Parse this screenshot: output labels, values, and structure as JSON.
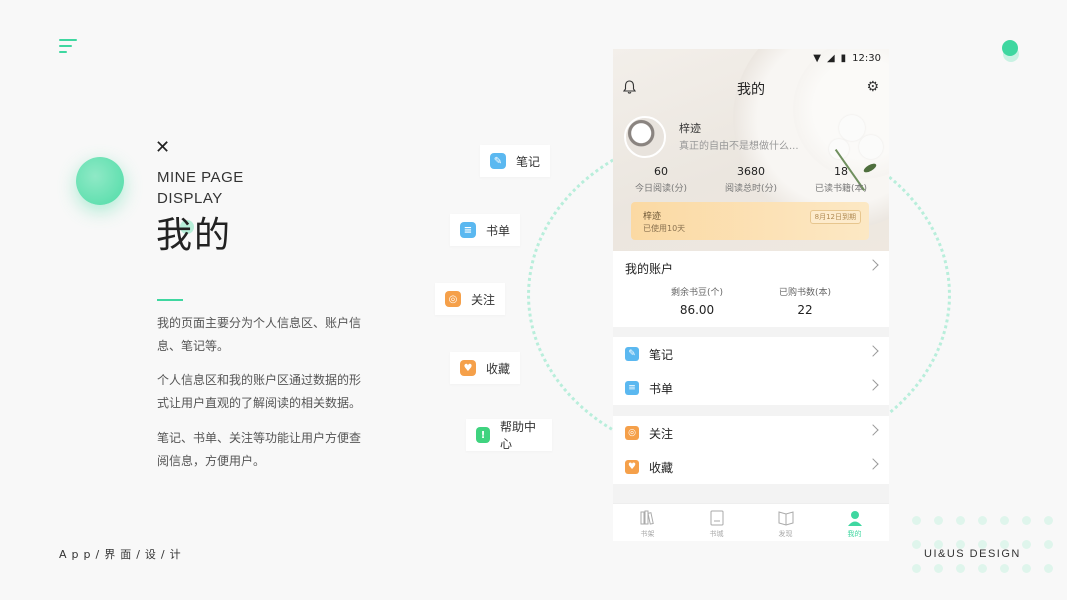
{
  "left": {
    "en_title_line1": "MINE PAGE",
    "en_title_line2": "DISPLAY",
    "zh_title": "我的",
    "desc1": "我的页面主要分为个人信息区、账户信息、笔记等。",
    "desc2": "个人信息区和我的账户区通过数据的形式让用户直观的了解阅读的相关数据。",
    "desc3": "笔记、书单、关注等功能让用户方便查阅信息，方便用户。"
  },
  "footer": {
    "left": "App/界面/设/计",
    "right": "UI&US DESIGN"
  },
  "features": [
    {
      "label": "笔记"
    },
    {
      "label": "书单"
    },
    {
      "label": "关注"
    },
    {
      "label": "收藏"
    },
    {
      "label": "帮助中心"
    }
  ],
  "phone": {
    "status_time": "12:30",
    "title": "我的",
    "user_name": "梓迹",
    "user_signature": "真正的自由不是想做什么...",
    "stats": [
      {
        "value": "60",
        "label": "今日阅读(分)"
      },
      {
        "value": "3680",
        "label": "阅读总时(分)"
      },
      {
        "value": "18",
        "label": "已读书籍(本)"
      }
    ],
    "vip": {
      "name": "梓迹",
      "used": "已使用10天",
      "expire": "8月12日到期"
    },
    "account": {
      "title": "我的账户",
      "items": [
        {
          "label": "剩余书豆(个)",
          "value": "86.00"
        },
        {
          "label": "已购书数(本)",
          "value": "22"
        }
      ]
    },
    "menu1": [
      {
        "label": "笔记"
      },
      {
        "label": "书单"
      }
    ],
    "menu2": [
      {
        "label": "关注"
      },
      {
        "label": "收藏"
      }
    ],
    "tabs": [
      {
        "label": "书架"
      },
      {
        "label": "书城"
      },
      {
        "label": "发现"
      },
      {
        "label": "我的"
      }
    ]
  },
  "colors": {
    "accent": "#3fd7a0",
    "blue_icon": "#5bb8f0",
    "orange_icon": "#f5a04a",
    "green_icon": "#3fd37f"
  }
}
